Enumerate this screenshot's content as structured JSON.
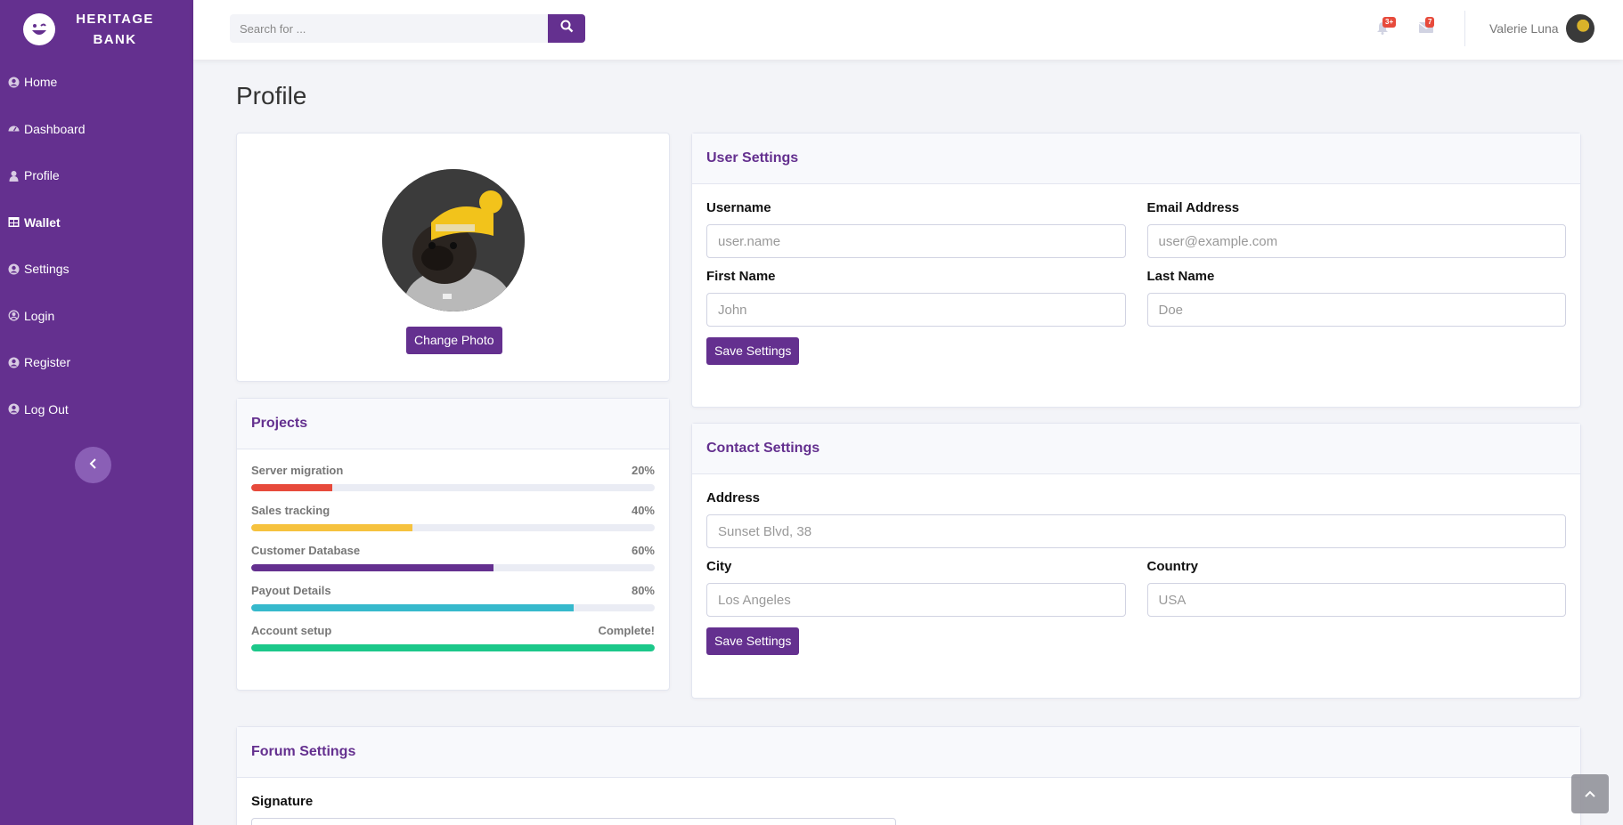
{
  "brand": {
    "name": "HERITAGE BANK"
  },
  "nav": {
    "items": [
      {
        "label": "Home",
        "icon": "user-circle-icon",
        "active": false
      },
      {
        "label": "Dashboard",
        "icon": "tachometer-icon",
        "active": false
      },
      {
        "label": "Profile",
        "icon": "user-icon",
        "active": false
      },
      {
        "label": "Wallet",
        "icon": "table-icon",
        "active": true
      },
      {
        "label": "Settings",
        "icon": "user-circle-icon",
        "active": false
      },
      {
        "label": "Login",
        "icon": "user-circle-icon",
        "active": false
      },
      {
        "label": "Register",
        "icon": "user-circle-icon",
        "active": false
      },
      {
        "label": "Log Out",
        "icon": "user-circle-icon",
        "active": false
      }
    ]
  },
  "topbar": {
    "search_placeholder": "Search for ...",
    "alerts_count": "3+",
    "messages_count": "7",
    "user_name": "Valerie Luna"
  },
  "page": {
    "title": "Profile"
  },
  "photo_card": {
    "button": "Change Photo"
  },
  "projects": {
    "title": "Projects",
    "items": [
      {
        "name": "Server migration",
        "status": "20%",
        "progress": 0.2,
        "color": "#e74a3b"
      },
      {
        "name": "Sales tracking",
        "status": "40%",
        "progress": 0.4,
        "color": "#f6c23e"
      },
      {
        "name": "Customer Database",
        "status": "60%",
        "progress": 0.6,
        "color": "#64308f"
      },
      {
        "name": "Payout Details",
        "status": "80%",
        "progress": 0.8,
        "color": "#36b9cc"
      },
      {
        "name": "Account setup",
        "status": "Complete!",
        "progress": 1.0,
        "color": "#1cc88a"
      }
    ]
  },
  "user_settings": {
    "title": "User Settings",
    "username_label": "Username",
    "username_placeholder": "user.name",
    "email_label": "Email Address",
    "email_placeholder": "user@example.com",
    "first_name_label": "First Name",
    "first_name_placeholder": "John",
    "last_name_label": "Last Name",
    "last_name_placeholder": "Doe",
    "save": "Save Settings"
  },
  "contact_settings": {
    "title": "Contact Settings",
    "address_label": "Address",
    "address_placeholder": "Sunset Blvd, 38",
    "city_label": "City",
    "city_placeholder": "Los Angeles",
    "country_label": "Country",
    "country_placeholder": "USA",
    "save": "Save Settings"
  },
  "forum_settings": {
    "title": "Forum Settings",
    "signature_label": "Signature"
  },
  "colors": {
    "primary": "#64308f",
    "sidebar": "#64308f"
  }
}
